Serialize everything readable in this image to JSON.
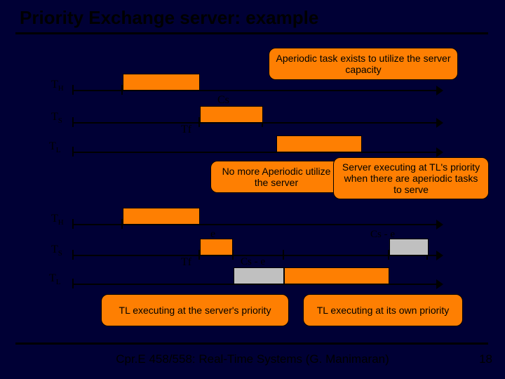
{
  "title": "Priority Exchange server: example",
  "rows": {
    "TH": "T",
    "TH_sub": "H",
    "TS": "T",
    "TS_sub": "S",
    "TL": "T",
    "TL_sub": "L"
  },
  "labels": {
    "Cs": "Cs",
    "Tf": "Tf",
    "e": "e",
    "Cs_minus_e_1": "Cs - e",
    "Cs_minus_e_2": "Cs - e"
  },
  "callouts": {
    "c1": "Aperiodic task exists to utilize the server capacity",
    "c2": "No more Aperiodic utilize the server",
    "c3": "Server executing at TL's priority when there are aperiodic tasks to serve",
    "c4": "TL executing at the server's priority",
    "c5": "TL executing at its own priority"
  },
  "footer": "Cpr.E 458/558: Real-Time Systems (G. Manimaran)",
  "page": "18"
}
